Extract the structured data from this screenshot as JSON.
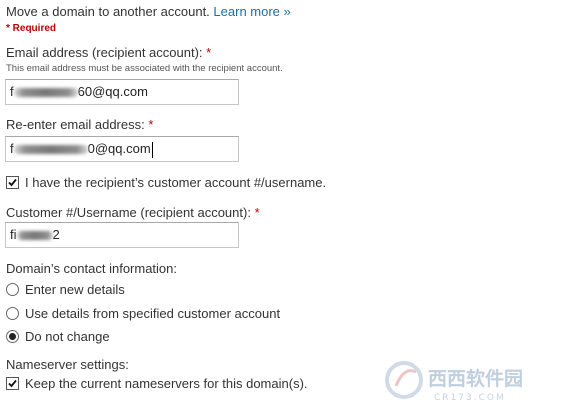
{
  "form": {
    "intro_text": "Move a domain to another account.",
    "learn_more": "Learn more »",
    "required_note": "* Required",
    "email": {
      "label": "Email address (recipient account):",
      "star": "*",
      "hint": "This email address must be associated with the recipient account.",
      "prefix": "f",
      "suffix": "60@qq.com"
    },
    "reenter_email": {
      "label": "Re-enter email address:",
      "star": "*",
      "prefix": "f",
      "suffix": "0@qq.com"
    },
    "has_account_checkbox": {
      "label": "I have the recipient’s customer account #/username.",
      "checked": true
    },
    "customer_id": {
      "label": "Customer #/Username (recipient account):",
      "star": "*",
      "prefix": "fi",
      "suffix": "2"
    },
    "contact": {
      "heading": "Domain’s contact information:",
      "options": [
        {
          "label": "Enter new details",
          "selected": false
        },
        {
          "label": "Use details from specified customer account",
          "selected": false
        },
        {
          "label": "Do not change",
          "selected": true
        }
      ]
    },
    "nameserver": {
      "heading": "Nameserver settings:",
      "keep_label": "Keep the current nameservers for this domain(s).",
      "checked": true
    }
  },
  "colors": {
    "link": "#1a6fa8",
    "required": "#c00000",
    "text": "#333333"
  },
  "watermark": {
    "brand_text": "西西软件园",
    "sub_text": "CR173.COM"
  }
}
